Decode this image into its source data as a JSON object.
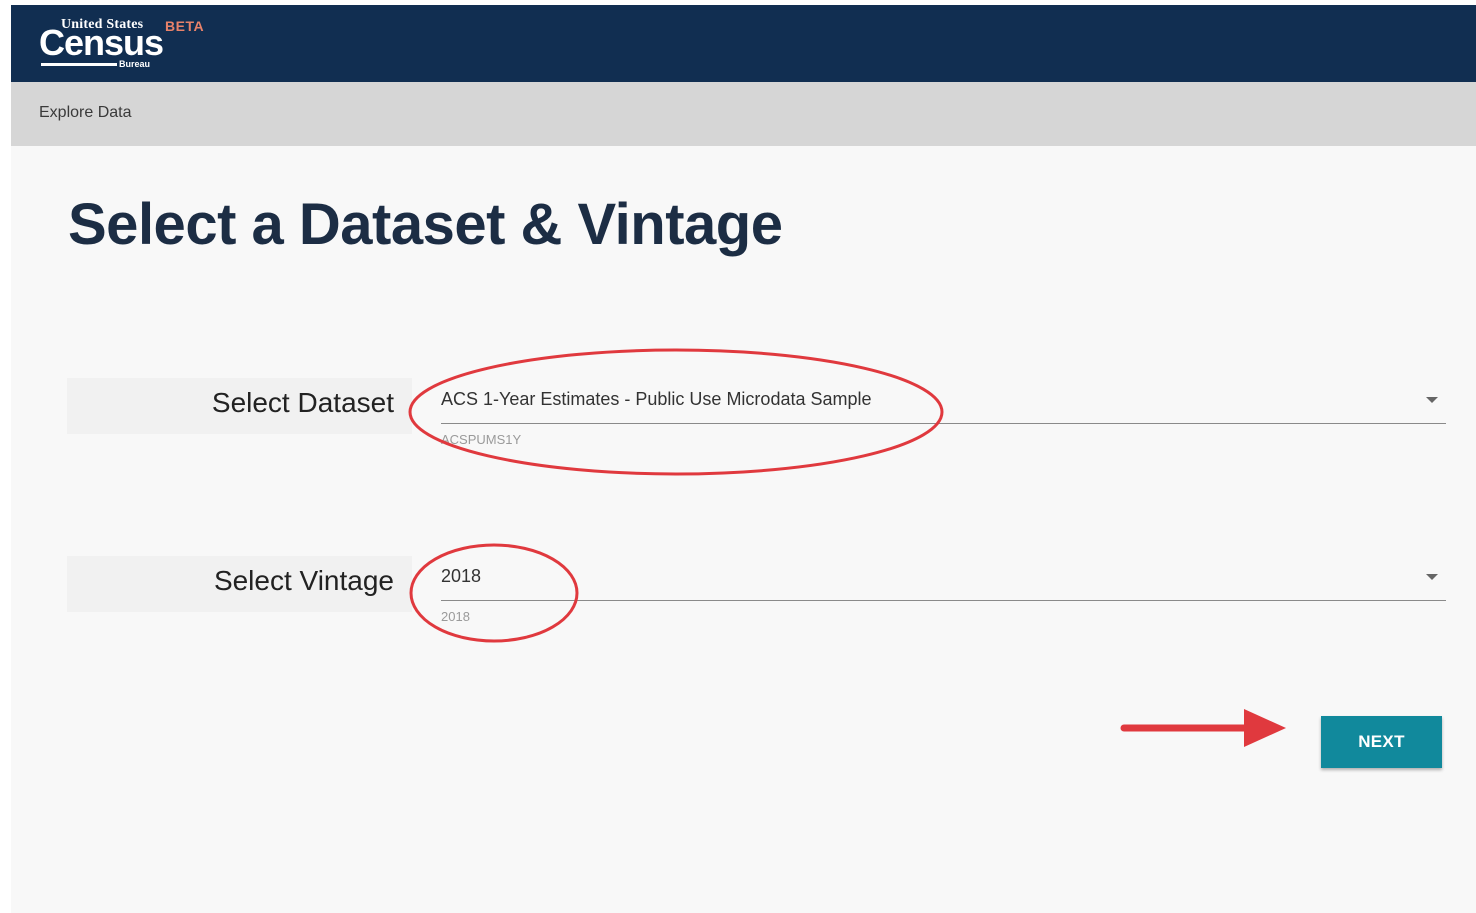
{
  "header": {
    "logo_united_states": "United States",
    "logo_census": "Census",
    "logo_bureau": "Bureau",
    "beta_label": "BETA",
    "bg_color": "#112e51"
  },
  "breadcrumb": {
    "label": "Explore Data"
  },
  "page": {
    "title": "Select a Dataset & Vintage"
  },
  "dataset": {
    "label": "Select Dataset",
    "value": "ACS 1-Year Estimates - Public Use Microdata Sample",
    "helper": "ACSPUMS1Y"
  },
  "vintage": {
    "label": "Select Vintage",
    "value": "2018",
    "helper": "2018"
  },
  "actions": {
    "next_label": "NEXT",
    "next_color": "#11899c"
  },
  "annotation_color": "#e0393e"
}
